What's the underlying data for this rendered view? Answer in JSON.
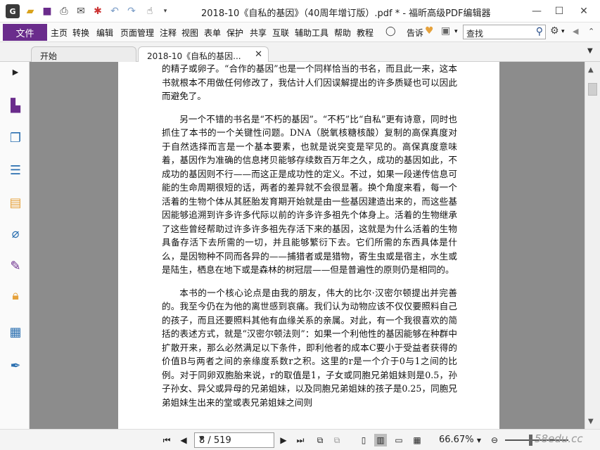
{
  "titlebar": {
    "title": "2018-10《自私的基因》（40周年增订版）.pdf * - 福昕高级PDF编辑器",
    "logo_text": "G",
    "icons": [
      "folder-open-icon",
      "save-icon",
      "print-icon",
      "email-icon",
      "new-icon",
      "undo-icon",
      "redo-icon",
      "hand-tool-icon"
    ],
    "minimize": "—",
    "maximize": "☐",
    "close": "✕"
  },
  "menubar": {
    "file": "文件",
    "items": [
      "主页",
      "转换",
      "编辑",
      "页面管理",
      "注释",
      "视图",
      "表单",
      "保护",
      "共享",
      "互联",
      "辅助工具",
      "帮助",
      "教程"
    ],
    "tell_me": "告诉",
    "search_placeholder": "查找",
    "search_value": "查找"
  },
  "tabs": [
    {
      "label": "开始"
    },
    {
      "label": "2018-10《自私的基因...",
      "close": "✕"
    }
  ],
  "document": {
    "paragraphs": [
      "的精子或卵子。“合作的基因”也是一个同样恰当的书名，而且此一来，这本书就根本不用做任何修改了，我估计人们因误解提出的许多质疑也可以因此而避免了。",
      "另一个不错的书名是“不朽的基因”。“不朽”比“自私”更有诗意，同时也抓住了本书的一个关键性问题。DNA（脱氧核糖核酸）复制的高保真度对于自然选择而言是一个基本要素，也就是说突变是罕见的。高保真度意味着，基因作为准确的信息拷贝能够存续数百万年之久，成功的基因如此，不成功的基因则不行——而这正是成功性的定义。不过，如果一段递传信息可能的生命周期很短的话，两者的差异就不会很显著。换个角度来看，每一个活着的生物个体从其胚胎发育期开始就是由一些基因建造出来的，而这些基因能够追溯到许多许多代际以前的许多许多祖先个体身上。活着的生物继承了这些曾经帮助过许多许多祖先存活下来的基因，这就是为什么活着的生物具备存活下去所需的一切，并且能够繁衍下去。它们所需的东西具体是什么，是因物种不同而各异的——捕猎者或是猎物，寄生虫或是宿主，水生或是陆生，栖息在地下或是森林的树冠层——但是普遍性的原则仍是相同的。",
      "本书的一个核心论点是由我的朋友，伟大的比尔·汉密尔顿提出并完善的。我至今仍在为他的离世感到哀痛。我们认为动物应该不仅仅要照料自己的孩子，而且还要照料其他有血缘关系的亲属。对此，有一个我很喜欢的简括的表述方式，就是“汉密尔顿法则”：如果一个利他性的基因能够在种群中扩散开来，那么必然满足以下条件，即利他者的成本C要小于受益者获得的价值B与两者之间的亲缘度系数r之积。这里的r是一个介于0与1之间的比例。对于同卵双胞胎来说，r的取值是1，子女或同胞兄弟姐妹则是0.5，孙子孙女、异父或异母的兄弟姐妹，以及同胞兄弟姐妹的孩子是0.25，同胞兄弟姐妹生出来的堂或表兄弟姐妹之间则"
    ]
  },
  "statusbar": {
    "page_display": "8 / 519",
    "zoom": "66.67%",
    "watermark": "58edu.cc"
  }
}
